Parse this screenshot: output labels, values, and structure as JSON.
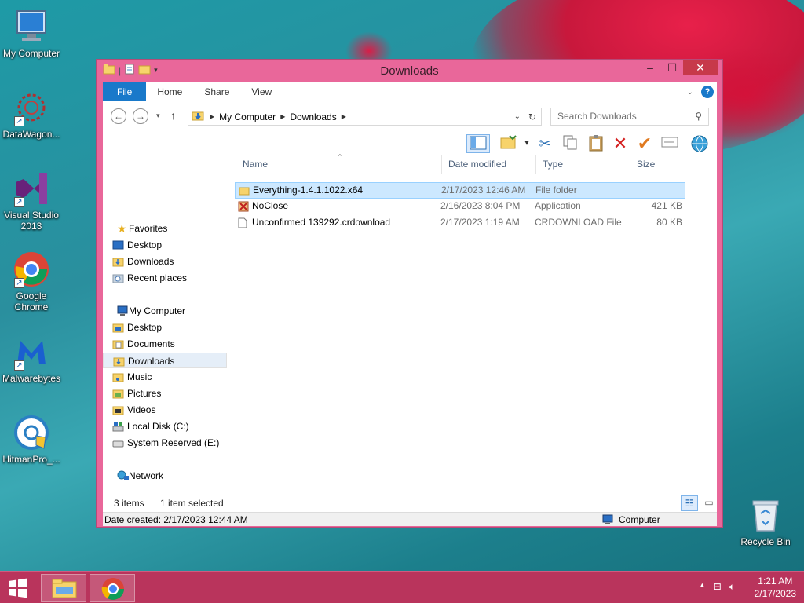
{
  "desktop": {
    "icons": [
      {
        "label": "My Computer",
        "icon": "computer-icon"
      },
      {
        "label": "DataWagon...",
        "icon": "datawagon-icon"
      },
      {
        "label": "Visual Studio 2013",
        "icon": "visual-studio-icon"
      },
      {
        "label": "Google Chrome",
        "icon": "chrome-icon"
      },
      {
        "label": "Malwarebytes",
        "icon": "malwarebytes-icon"
      },
      {
        "label": "HitmanPro_...",
        "icon": "hitmanpro-icon"
      },
      {
        "label": "Recycle Bin",
        "icon": "recycle-bin-icon"
      }
    ]
  },
  "window": {
    "title": "Downloads",
    "ribbon_tabs": [
      "File",
      "Home",
      "Share",
      "View"
    ],
    "nav_back": "←",
    "nav_forward": "→",
    "nav_up": "↑",
    "breadcrumb": [
      "My Computer",
      "Downloads"
    ],
    "search_placeholder": "Search Downloads",
    "columns": [
      "Name",
      "Date modified",
      "Type",
      "Size"
    ],
    "files": [
      {
        "name": "Everything-1.4.1.1022.x64",
        "date": "2/17/2023 12:46 AM",
        "type": "File folder",
        "size": "",
        "icon": "folder-icon"
      },
      {
        "name": "NoClose",
        "date": "2/16/2023 8:04 PM",
        "type": "Application",
        "size": "421 KB",
        "icon": "application-icon"
      },
      {
        "name": "Unconfirmed 139292.crdownload",
        "date": "2/17/2023 1:19 AM",
        "type": "CRDOWNLOAD File",
        "size": "80 KB",
        "icon": "file-icon"
      }
    ],
    "nav_pane": {
      "favorites_label": "Favorites",
      "favorites": [
        "Desktop",
        "Downloads",
        "Recent places"
      ],
      "computer_label": "My Computer",
      "computer": [
        "Desktop",
        "Documents",
        "Downloads",
        "Music",
        "Pictures",
        "Videos",
        "Local Disk (C:)",
        "System Reserved (E:)"
      ],
      "network_label": "Network"
    },
    "status_count": "3 items",
    "status_selected": "1 item selected",
    "info_date": "Date created: 2/17/2023 12:44 AM",
    "info_location": "Computer"
  },
  "taskbar": {
    "time": "1:21 AM",
    "date": "2/17/2023"
  },
  "colors": {
    "window_frame": "#e9679a",
    "taskbar": "#b9345c",
    "selection": "#cce8ff",
    "file_tab": "#1979ca"
  }
}
